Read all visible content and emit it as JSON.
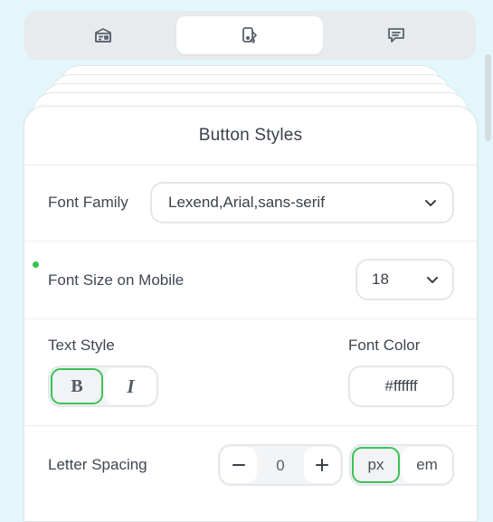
{
  "tabs": [
    {
      "icon": "card-settings-icon"
    },
    {
      "icon": "paint-bucket-icon",
      "active": true
    },
    {
      "icon": "chat-message-icon"
    }
  ],
  "panel": {
    "title": "Button Styles",
    "font_family": {
      "label": "Font Family",
      "value": "Lexend,Arial,sans-serif"
    },
    "font_size_mobile": {
      "label": "Font Size on Mobile",
      "value": "18"
    },
    "text_style": {
      "label": "Text Style",
      "bold": "B",
      "italic": "I",
      "selected": "bold"
    },
    "font_color": {
      "label": "Font Color",
      "value": "#ffffff"
    },
    "letter_spacing": {
      "label": "Letter Spacing",
      "value": "0",
      "units": [
        "px",
        "em"
      ],
      "selected_unit": "px"
    }
  },
  "colors": {
    "accent": "#3cc257",
    "indicator": "#34c24a",
    "background": "#e3f6fb"
  }
}
